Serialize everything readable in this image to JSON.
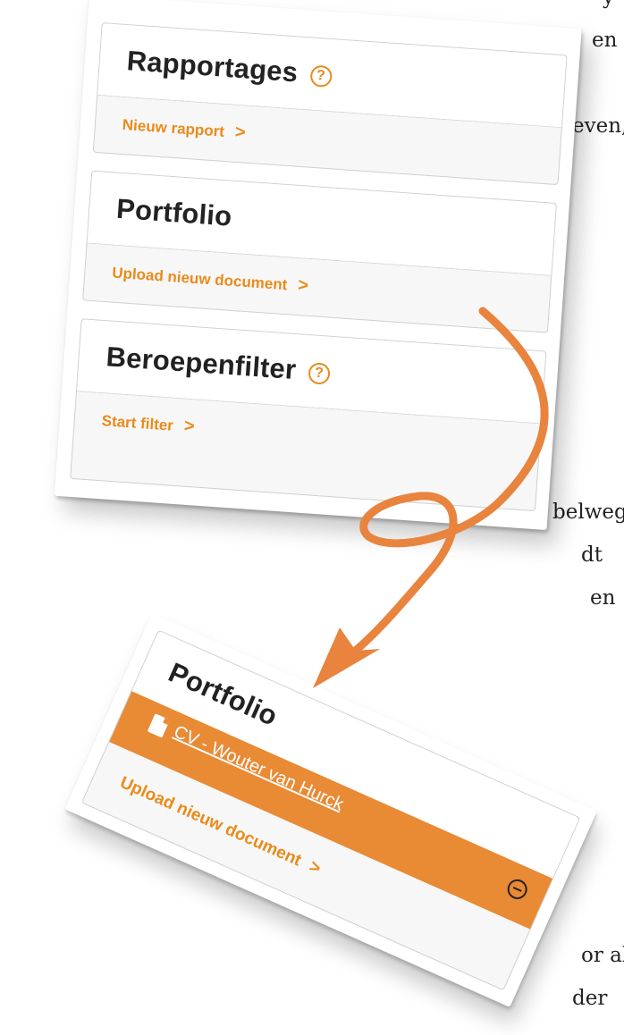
{
  "background_text": [
    "y",
    "en",
    "even,",
    "belweg",
    "dt",
    "en",
    "or al",
    "der"
  ],
  "top_panel": {
    "cards": [
      {
        "title": "Rapportages",
        "help": "?",
        "link": "Nieuw rapport",
        "chevron": ">"
      },
      {
        "title": "Portfolio",
        "link": "Upload nieuw document",
        "chevron": ">"
      },
      {
        "title": "Beroepenfilter",
        "help": "?",
        "link": "Start filter",
        "chevron": ">"
      }
    ]
  },
  "zoom_panel": {
    "title": "Portfolio",
    "document": "CV - Wouter van Hurck",
    "link": "Upload nieuw document",
    "chevron": ">",
    "file_icon": "pdf-file-icon",
    "remove_icon": "minus-circle-icon"
  },
  "colors": {
    "accent": "#e98b1b",
    "highlight_row": "#e98a34",
    "arrow": "#e8843e"
  }
}
